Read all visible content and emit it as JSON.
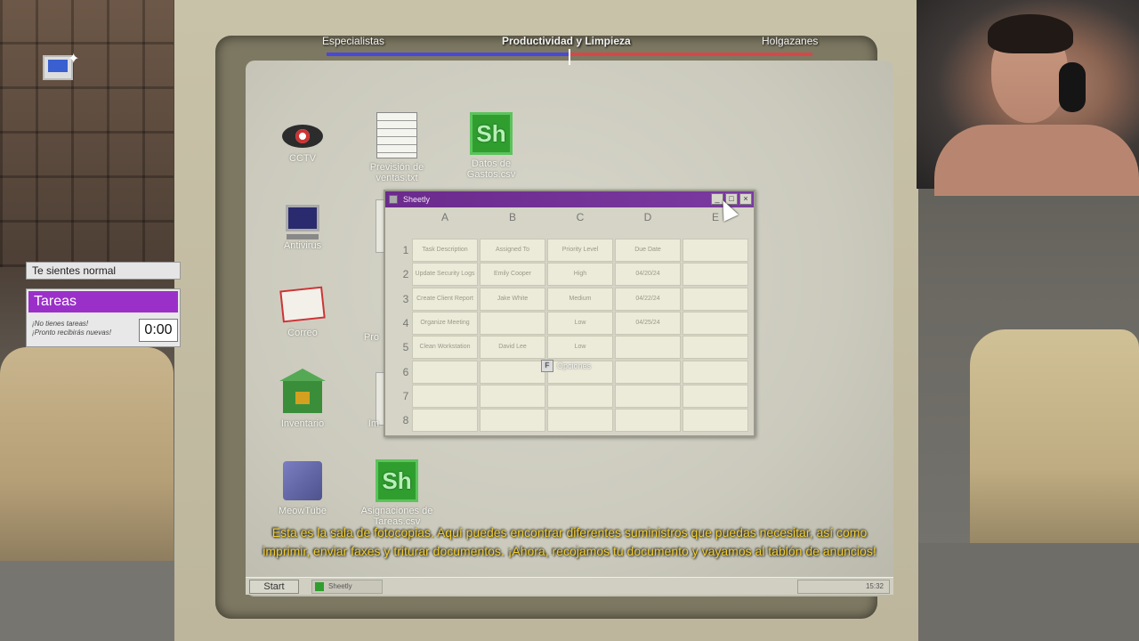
{
  "hud": {
    "progress_left_label": "Especialistas",
    "progress_center_label": "Productividad y Limpieza",
    "progress_right_label": "Holgazanes",
    "progress_value": 0.5,
    "status_text": "Te sientes normal",
    "tasks_title": "Tareas",
    "tasks_message_line1": "¡No tienes tareas!",
    "tasks_message_line2": "¡Pronto recibirás nuevas!",
    "timer": "0:00",
    "computer_icon": "computer-alert-icon"
  },
  "desktop": {
    "icons": [
      {
        "label": "CCTV",
        "icon": "eye-icon"
      },
      {
        "label": "Previsión de ventas.txt",
        "icon": "text-file-icon"
      },
      {
        "label": "Datos de Gastos.csv",
        "icon": "sheetly-file-icon"
      },
      {
        "label": "Antivirus",
        "icon": "computer-icon"
      },
      {
        "label": "Correo",
        "icon": "mail-icon"
      },
      {
        "label": "Inventario",
        "icon": "warehouse-icon"
      },
      {
        "label": "MeowTube",
        "icon": "cat-video-icon"
      },
      {
        "label": "Asignaciones de Tareas.csv",
        "icon": "sheetly-file-icon"
      }
    ],
    "partial_labels": [
      "Pro",
      "Im"
    ]
  },
  "sheetly": {
    "title": "Sheetly",
    "columns": [
      "A",
      "B",
      "C",
      "D",
      "E"
    ],
    "rows": [
      "1",
      "2",
      "3",
      "4",
      "5",
      "6",
      "7",
      "8"
    ],
    "cells": [
      [
        "Task Description",
        "Assigned To",
        "Priority Level",
        "Due Date",
        ""
      ],
      [
        "Update Security Logs",
        "Emily Cooper",
        "High",
        "04/20/24",
        ""
      ],
      [
        "Create Client Report",
        "Jake White",
        "Medium",
        "04/22/24",
        ""
      ],
      [
        "Organize Meeting",
        "",
        "Low",
        "04/25/24",
        ""
      ],
      [
        "Clean Workstation",
        "David Lee",
        "Low",
        "",
        ""
      ],
      [
        "",
        "",
        "",
        "",
        ""
      ],
      [
        "",
        "",
        "",
        "",
        ""
      ],
      [
        "",
        "",
        "",
        "",
        ""
      ]
    ],
    "options_key": "F",
    "options_label": "Opciones"
  },
  "taskbar": {
    "start_label": "Start",
    "task_label": "Sheetly",
    "clock": "15:32"
  },
  "subtitle": {
    "line1": "Esta es la sala de fotocopias. Aquí puedes encontrar diferentes suministros que puedas necesitar, así como",
    "line2": "imprimir, enviar faxes y triturar documentos. ¡Ahora, recojamos tu documento y vayamos al tablón de anuncios!"
  },
  "colors": {
    "title_bar": "#6b2a8c",
    "tasks_header": "#9b30c9",
    "progress_blue": "#4a48d9",
    "progress_red": "#d64848",
    "subtitle": "#f3cf2e",
    "sheetly_green": "#2f9e2f"
  }
}
